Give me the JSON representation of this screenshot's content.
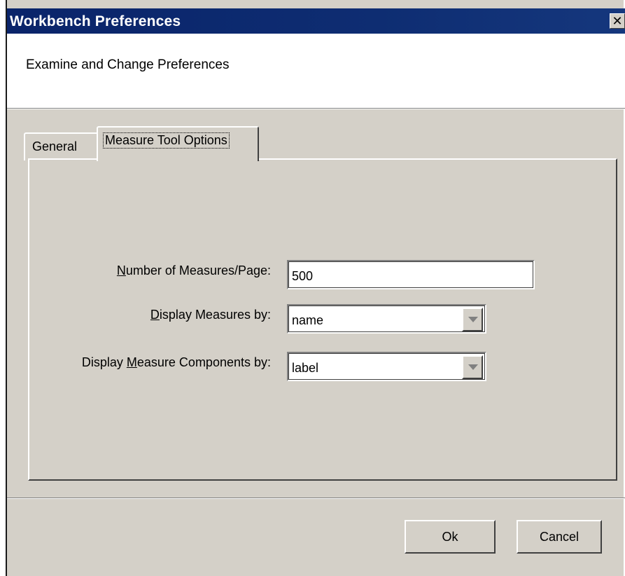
{
  "window": {
    "title": "Workbench Preferences",
    "close_glyph": "✕",
    "close_icon": "close-icon"
  },
  "header": {
    "subtitle": "Examine and Change Preferences"
  },
  "tabs": [
    {
      "label": "General",
      "selected": false
    },
    {
      "label": "Measure Tool Options",
      "selected": true
    }
  ],
  "form": {
    "measures_per_page": {
      "label_mnemonic": "N",
      "label_rest": "umber of Measures/Page:",
      "value": "500"
    },
    "display_measures_by": {
      "label_mnemonic": "D",
      "label_rest": "isplay Measures by:",
      "value": "name",
      "dropdown_icon": "chevron-down-icon"
    },
    "display_components_by": {
      "label_pre": "Display ",
      "label_mnemonic": "M",
      "label_rest": "easure Components by:",
      "value": "label",
      "dropdown_icon": "chevron-down-icon"
    }
  },
  "buttons": {
    "ok_label": "Ok",
    "cancel_label": "Cancel"
  },
  "colors": {
    "titlebar": "#0a246a",
    "face": "#d4d0c8"
  }
}
